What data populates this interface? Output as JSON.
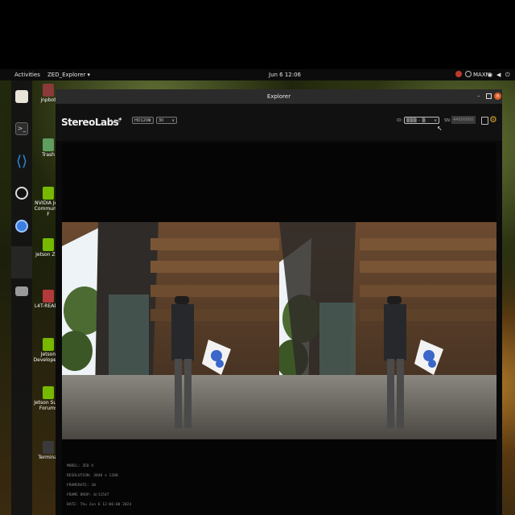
{
  "topbar": {
    "activities": "Activities",
    "app_menu": "ZED_Explorer",
    "clock": "Jun 6  12:06",
    "power_mode": "MAXN"
  },
  "dock": {
    "items": [
      "files-icon",
      "terminal-icon",
      "vscode-icon",
      "obs-icon",
      "chromium-icon",
      "show-apps-icon",
      "disk-icon"
    ]
  },
  "desktop": {
    "icons": [
      {
        "label": "jnpbot",
        "color": "#8a3a3a"
      },
      {
        "label": "Trash",
        "color": "#5f9e5f"
      },
      {
        "label": "NVIDIA Jets Community F",
        "color": "#76b900"
      },
      {
        "label": "Jetson Zoo",
        "color": "#76b900"
      },
      {
        "label": "L4T-READM",
        "color": "#b33a3a"
      },
      {
        "label": "Jetson Developer Z",
        "color": "#76b900"
      },
      {
        "label": "Jetson Supp Forums",
        "color": "#76b900"
      },
      {
        "label": "Terminal",
        "color": "#3a3a3a"
      }
    ]
  },
  "window": {
    "title": "Explorer"
  },
  "app": {
    "brand": "StereoLabs",
    "version": "1.1.0",
    "resolution_value": "HD1200",
    "fps_value": "30",
    "sn_label": "SN:",
    "sn_value": "44000000",
    "id_label": "ID:"
  },
  "info": {
    "model": "MODEL: ZED X",
    "resolution": "RESOLUTION: 3840 x 1200",
    "framerate": "FRAMERATE: 30",
    "frame_drop": "FRAME DROP: 0/11547",
    "date": "DATE: Thu Jun 6 12:06:00 2024"
  }
}
